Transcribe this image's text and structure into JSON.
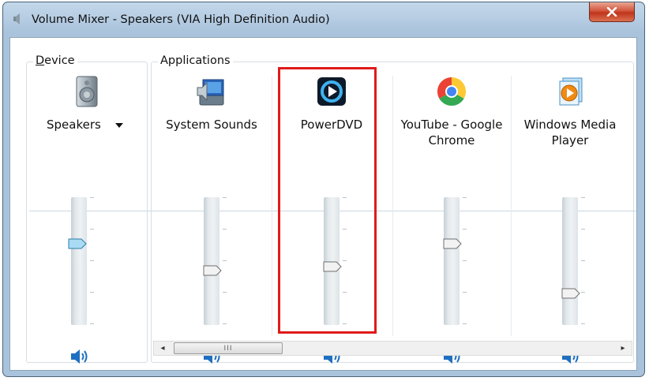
{
  "window": {
    "title": "Volume Mixer - Speakers (VIA High Definition Audio)",
    "close_glyph": "x"
  },
  "device": {
    "group_label": "Device",
    "name": "Speakers",
    "icon": "speaker-device-icon",
    "volume_percent": 65
  },
  "applications": {
    "group_label": "Applications",
    "items": [
      {
        "name": "System Sounds",
        "icon": "system-sounds-icon",
        "volume_percent": 42
      },
      {
        "name": "PowerDVD",
        "icon": "powerdvd-icon",
        "volume_percent": 45,
        "highlighted": true
      },
      {
        "name": "YouTube - Google Chrome",
        "name_line1": "YouTube - Google",
        "name_line2": "Chrome",
        "icon": "chrome-icon",
        "volume_percent": 65
      },
      {
        "name": "Windows Media Player",
        "name_line1": "Windows Media",
        "name_line2": "Player",
        "icon": "windows-media-player-icon",
        "volume_percent": 22
      }
    ]
  },
  "scrollbar": {
    "left_arrow": "◂",
    "right_arrow": "▸",
    "grip": "III"
  },
  "colors": {
    "highlight": "#e01a1a",
    "speaker_icon": "#1e6fc0"
  }
}
